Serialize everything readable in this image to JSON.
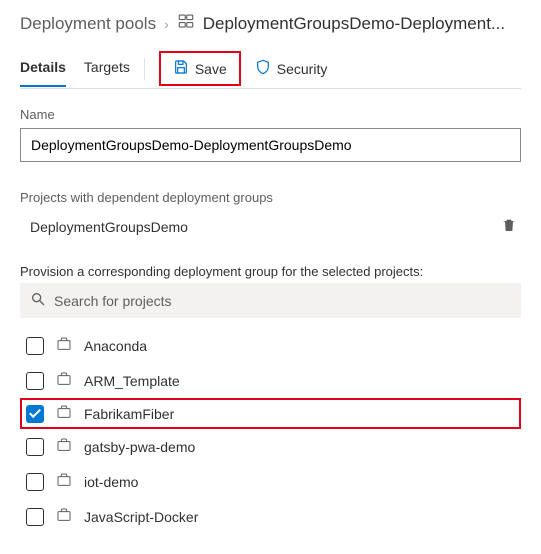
{
  "breadcrumb": {
    "parent": "Deployment pools",
    "current": "DeploymentGroupsDemo-Deployment..."
  },
  "tabs": {
    "details": "Details",
    "targets": "Targets"
  },
  "toolbar": {
    "save_label": "Save",
    "security_label": "Security"
  },
  "name_section": {
    "label": "Name",
    "value": "DeploymentGroupsDemo-DeploymentGroupsDemo"
  },
  "dependent_section": {
    "label": "Projects with dependent deployment groups",
    "project": "DeploymentGroupsDemo"
  },
  "provision_section": {
    "label": "Provision a corresponding deployment group for the selected projects:",
    "search_placeholder": "Search for projects",
    "projects": [
      {
        "name": "Anaconda",
        "checked": false
      },
      {
        "name": "ARM_Template",
        "checked": false
      },
      {
        "name": "FabrikamFiber",
        "checked": true
      },
      {
        "name": "gatsby-pwa-demo",
        "checked": false
      },
      {
        "name": "iot-demo",
        "checked": false
      },
      {
        "name": "JavaScript-Docker",
        "checked": false
      }
    ]
  }
}
